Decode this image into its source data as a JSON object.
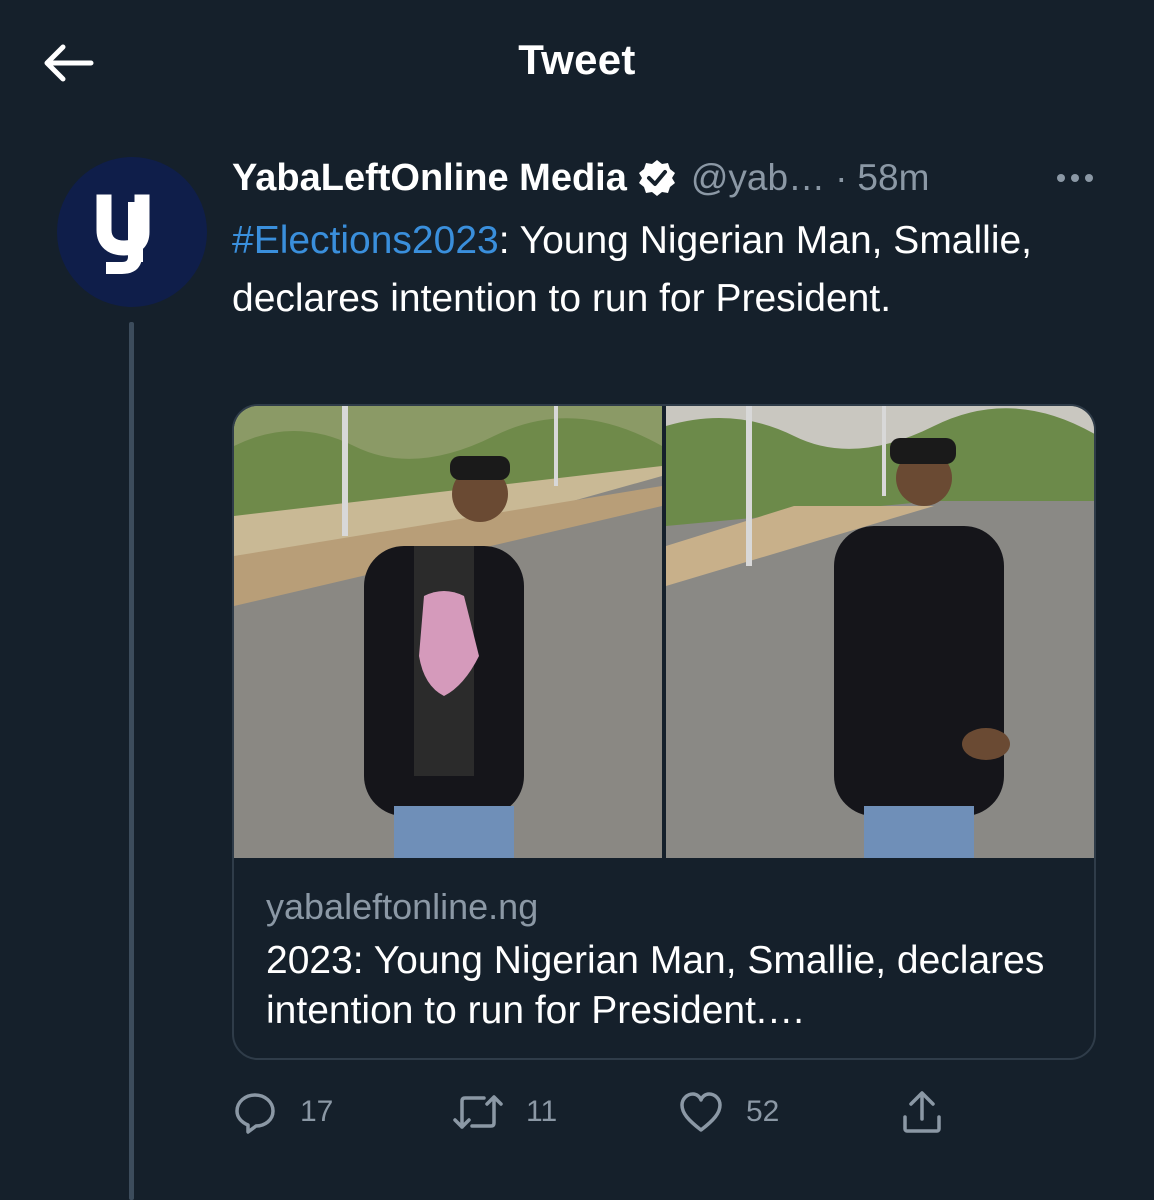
{
  "header": {
    "title": "Tweet"
  },
  "tweet": {
    "author_name": "YabaLeftOnline Media",
    "handle": "@yab…",
    "separator": "·",
    "time": "58m",
    "hashtag": "#Elections2023",
    "text_rest": ": Young Nigerian Man, Smallie, declares intention to run for President.",
    "avatar_letter": "y",
    "link_card": {
      "domain": "yabaleftonline.ng",
      "title": "2023: Young Nigerian Man, Smallie, declares intention to run for President.…"
    },
    "actions": {
      "replies": "17",
      "retweets": "11",
      "likes": "52"
    }
  },
  "colors": {
    "background": "#15202b",
    "link": "#3a8fdc",
    "secondary_text": "#8b98a5",
    "border": "#2f3c49",
    "avatar_bg": "#0f1e4a"
  },
  "icons": [
    "back-arrow-icon",
    "verified-badge-icon",
    "more-options-icon",
    "reply-icon",
    "retweet-icon",
    "like-icon",
    "share-icon"
  ]
}
